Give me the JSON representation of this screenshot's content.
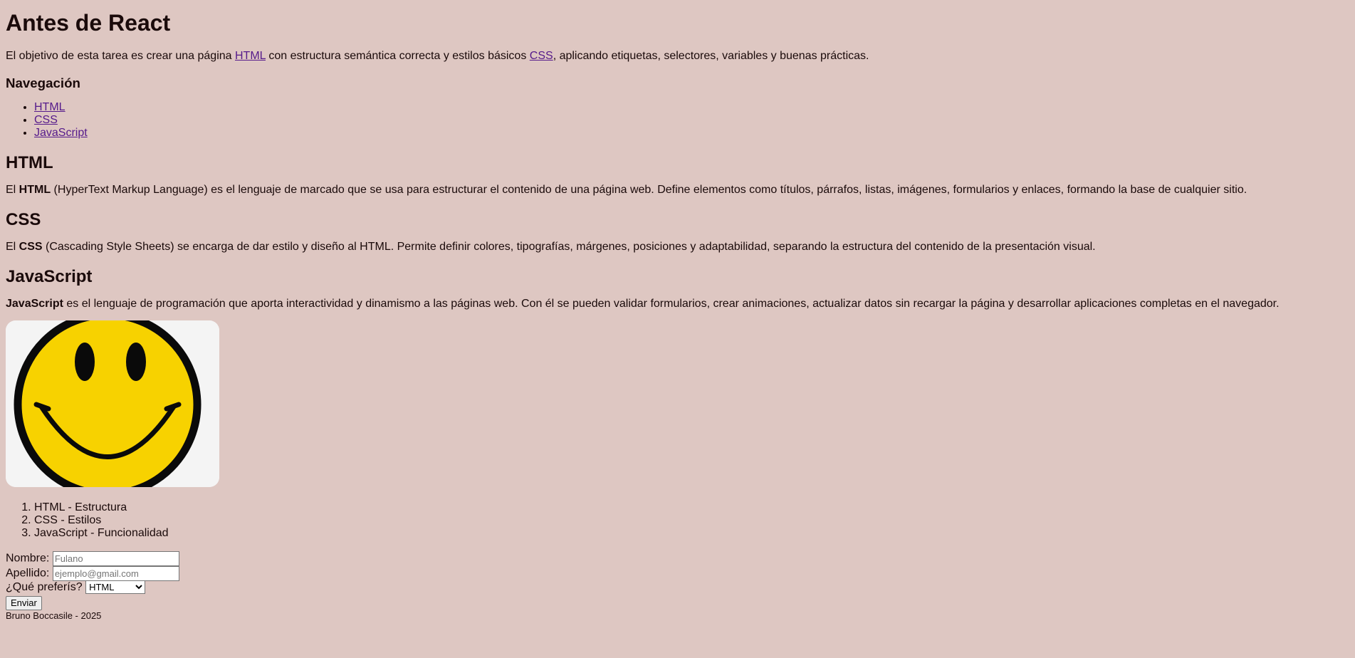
{
  "page": {
    "title": "Antes de React",
    "intro": {
      "before": "El objetivo de esta tarea es crear una página ",
      "link1": "HTML",
      "middle": " con estructura semántica correcta y estilos básicos ",
      "link2": "CSS",
      "after": ", aplicando etiquetas, selectores, variables y buenas prácticas."
    }
  },
  "nav": {
    "heading": "Navegación",
    "items": [
      "HTML",
      "CSS",
      "JavaScript"
    ]
  },
  "sections": [
    {
      "heading": "HTML",
      "prefix": "El ",
      "bold": "HTML",
      "text": " (HyperText Markup Language) es el lenguaje de marcado que se usa para estructurar el contenido de una página web. Define elementos como títulos, párrafos, listas, imágenes, formularios y enlaces, formando la base de cualquier sitio."
    },
    {
      "heading": "CSS",
      "prefix": "El ",
      "bold": "CSS",
      "text": " (Cascading Style Sheets) se encarga de dar estilo y diseño al HTML. Permite definir colores, tipografías, márgenes, posiciones y adaptabilidad, separando la estructura del contenido de la presentación visual."
    },
    {
      "heading": "JavaScript",
      "prefix": "",
      "bold": "JavaScript",
      "text": " es el lenguaje de programación que aporta interactividad y dinamismo a las páginas web. Con él se pueden validar formularios, crear animaciones, actualizar datos sin recargar la página y desarrollar aplicaciones completas en el navegador."
    }
  ],
  "image": {
    "icon": "smiley-face",
    "colors": {
      "face": "#f7d200",
      "outline": "#0a0a0a",
      "background": "#f4f4f4"
    }
  },
  "ordered_list": [
    "HTML - Estructura",
    "CSS - Estilos",
    "JavaScript - Funcionalidad"
  ],
  "form": {
    "nombre_label": "Nombre:",
    "nombre_placeholder": "Fulano",
    "apellido_label": "Apellido:",
    "apellido_placeholder": "ejemplo@gmail.com",
    "select_label": "¿Qué preferís?",
    "select_value": "HTML",
    "submit_label": "Enviar"
  },
  "footer": {
    "text": "Bruno Boccasile - 2025"
  },
  "colors": {
    "background": "#dec7c2",
    "link": "#551a8b",
    "text": "#1a0a0a"
  }
}
